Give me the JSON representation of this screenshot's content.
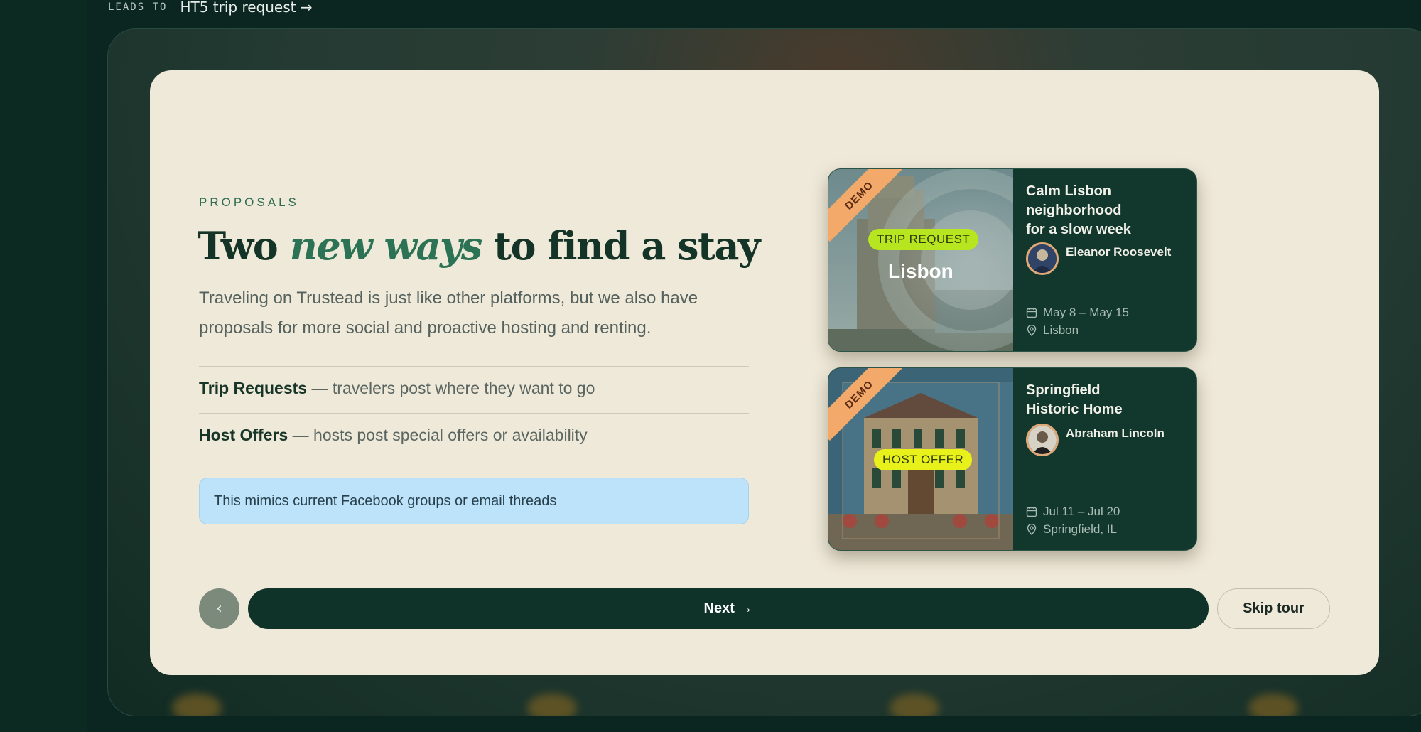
{
  "breadcrumb": {
    "key": "LEADS TO",
    "value": "HT5 trip request →"
  },
  "intro": {
    "eyebrow": "PROPOSALS",
    "title_before": "Two ",
    "title_emphasis": "new ways",
    "title_after": " to find a stay",
    "subtitle": "Traveling on Trustead is just like other platforms, but we also have proposals for more social and proactive hosting and renting."
  },
  "features": [
    {
      "label": "Trip Requests",
      "text": " — travelers post where they want to go"
    },
    {
      "label": "Host Offers",
      "text": " — hosts post special offers or availability"
    }
  ],
  "note": "This mimics current Facebook groups or email threads",
  "cards": [
    {
      "ribbon": "DEMO",
      "pill": "TRIP REQUEST",
      "pill_color": "#b7e51f",
      "image_label": "Lisbon",
      "title_lines": [
        "Calm Lisbon",
        "neighborhood",
        "for a slow week"
      ],
      "host": "Eleanor Roosevelt",
      "dates": "May 8 – May 15",
      "location": "Lisbon",
      "calendar_icon": "calendar-icon",
      "location_icon": "map-pin-icon"
    },
    {
      "ribbon": "DEMO",
      "pill": "HOST OFFER",
      "pill_color": "#e8f11a",
      "title_lines": [
        "Springfield",
        "Historic Home"
      ],
      "host": "Abraham Lincoln",
      "dates": "Jul 11 – Jul 20",
      "location": "Springfield, IL",
      "calendar_icon": "calendar-icon",
      "location_icon": "map-pin-icon"
    }
  ],
  "nav": {
    "back_icon": "chevron-left-icon",
    "back_glyph": "‹",
    "next_label": "Next →",
    "skip_label": "Skip tour"
  },
  "colors": {
    "accent_green": "#2c7254",
    "dark_green": "#0f3328",
    "cream": "#efe9da",
    "note_blue": "#bde3fa",
    "ribbon_orange": "#f3a96a"
  }
}
